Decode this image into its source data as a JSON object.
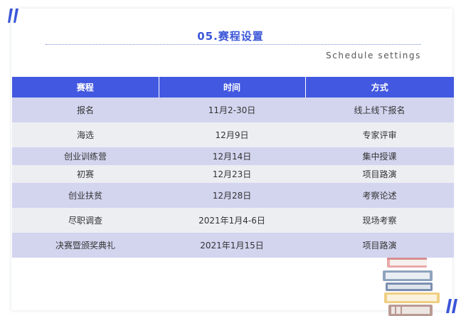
{
  "header": {
    "title": "05.赛程设置",
    "subtitle": "Schedule settings"
  },
  "table": {
    "columns": [
      "赛程",
      "时间",
      "方式"
    ],
    "rows": [
      {
        "stage": "报名",
        "time": "11月2-30日",
        "method": "线上线下报名"
      },
      {
        "stage": "海选",
        "time": "12月9日",
        "method": "专家评审"
      },
      {
        "stage": "创业训练营",
        "time": "12月14日",
        "method": "集中授课"
      },
      {
        "stage": "初赛",
        "time": "12月23日",
        "method": "项目路演"
      },
      {
        "stage": "创业扶贫",
        "time": "12月28日",
        "method": "考察论述"
      },
      {
        "stage": "尽职调查",
        "time": "2021年1月4-6日",
        "method": "现场考察"
      },
      {
        "stage": "决赛暨颁奖典礼",
        "time": "2021年1月15日",
        "method": "项目路演"
      }
    ]
  },
  "colors": {
    "accent": "#4358e0",
    "title": "#3b56d8",
    "row_blue": "#d3d5ef",
    "row_grey": "#edeef2"
  },
  "icons": {
    "corner": "slash-marks-icon",
    "decoration": "book-stack-icon"
  }
}
